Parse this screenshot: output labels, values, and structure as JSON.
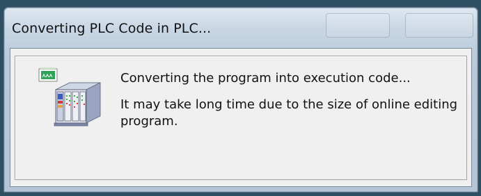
{
  "dialog": {
    "title": "Converting PLC Code in PLC...",
    "message_primary": "Converting the program into execution code...",
    "message_secondary": "It may take long time due to the size of online editing program.",
    "icon": "plc-rack-icon"
  },
  "colors": {
    "titlebar_top": "#dfe8f1",
    "titlebar_bottom": "#b3c5d6",
    "client_background": "#f0f0f0",
    "text": "#111111"
  }
}
